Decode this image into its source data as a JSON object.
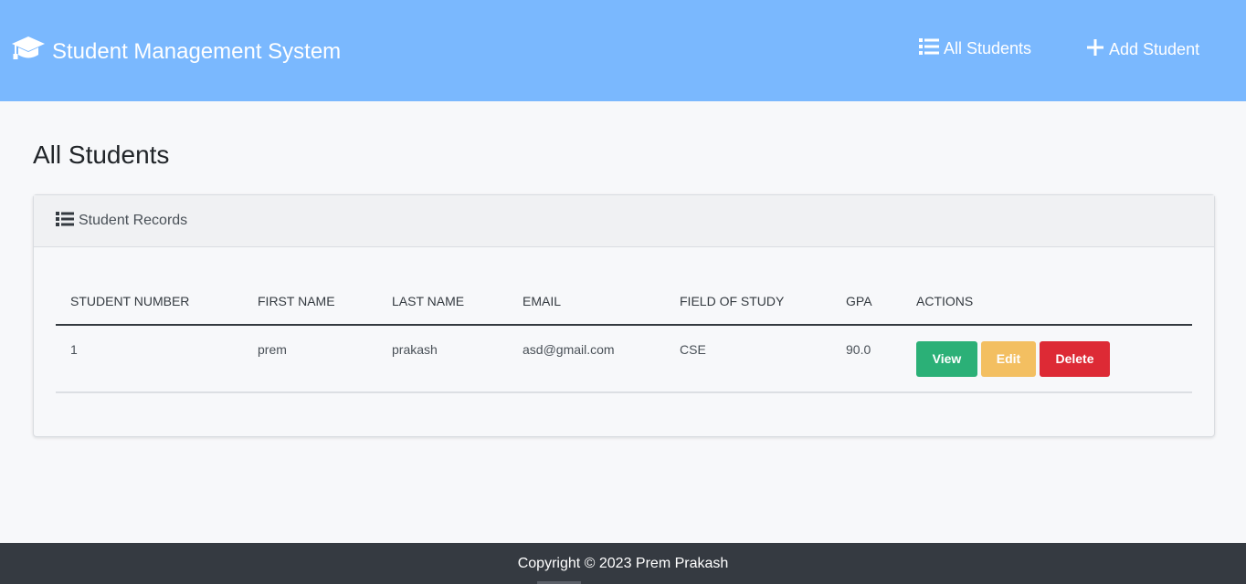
{
  "navbar": {
    "brand_text": "Student Management System",
    "brand_icon": "graduation-cap-icon",
    "links": [
      {
        "label": "All Students",
        "icon": "list-icon"
      },
      {
        "label": "Add Student",
        "icon": "plus-icon"
      }
    ],
    "background": "#7ab8fe"
  },
  "page": {
    "title": "All Students"
  },
  "card": {
    "header_label": "Student Records",
    "header_icon": "list-icon"
  },
  "table": {
    "columns": [
      "STUDENT NUMBER",
      "FIRST NAME",
      "LAST NAME",
      "EMAIL",
      "FIELD OF STUDY",
      "GPA",
      "ACTIONS"
    ],
    "rows": [
      {
        "student_number": "1",
        "first_name": "prem",
        "last_name": "prakash",
        "email": "asd@gmail.com",
        "field_of_study": "CSE",
        "gpa": "90.0"
      }
    ],
    "actions": {
      "view_label": "View",
      "edit_label": "Edit",
      "delete_label": "Delete",
      "view_color": "#2bb077",
      "edit_color": "#f3bf61",
      "delete_color": "#dd2a35"
    }
  },
  "footer": {
    "text": "Copyright © 2023 Prem Prakash",
    "background": "#353a41"
  }
}
